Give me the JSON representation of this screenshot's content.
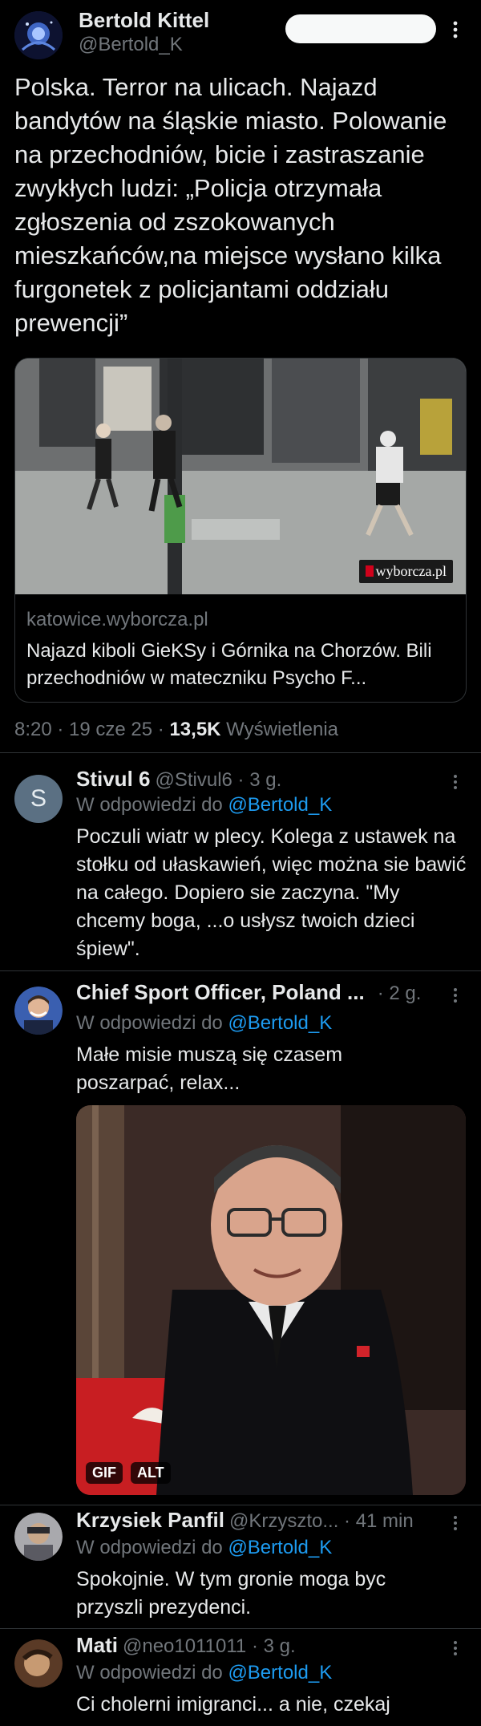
{
  "main_tweet": {
    "author_name": "Bertold Kittel",
    "author_handle": "@Bertold_K",
    "text": "Polska. Terror na ulicach. Najazd bandytów na śląskie miasto. Polowanie na przechodniów, bicie i zastraszanie zwykłych ludzi: „Policja otrzymała zgłoszenia od zszokowanych mieszkańców,na miejsce wysłano kilka furgonetek z policjantami oddziału prewencji”",
    "card": {
      "domain": "katowice.wyborcza.pl",
      "title": "Najazd kiboli GieKSy i Górnika na Chorzów. Bili przechodniów w mateczniku Psycho F...",
      "watermark": "wyborcza.pl"
    },
    "time": "8:20 · 19 cze 25 · ",
    "views_count": "13,5K",
    "views_label": " Wyświetlenia",
    "more_icon": "more-vertical-icon"
  },
  "replies": [
    {
      "avatar_letter": "S",
      "name": "Stivul 6",
      "handle_time": "@Stivul6 · 3 g.",
      "replying_prefix": "W odpowiedzi do ",
      "replying_to": "@Bertold_K",
      "text": "Poczuli wiatr w plecy. Kolega z ustawek na stołku od ułaskawień, więc można sie bawić na całego. Dopiero sie zaczyna. \"My chcemy boga, ...o usłysz twoich dzieci śpiew\"."
    },
    {
      "name": "Chief Sport Officer, Poland ...",
      "handle_time": "· 2 g.",
      "replying_prefix": "W odpowiedzi do ",
      "replying_to": "@Bertold_K",
      "text": "Małe misie muszą się czasem poszarpać, relax...",
      "media_badges": [
        "GIF",
        "ALT"
      ]
    },
    {
      "name": "Krzysiek Panfil",
      "handle_time": "@Krzyszto... · 41 min",
      "replying_prefix": "W odpowiedzi do ",
      "replying_to": "@Bertold_K",
      "text": "Spokojnie. W tym gronie moga byc przyszli prezydenci."
    },
    {
      "name": "Mati",
      "handle_time": "@neo1011011 · 3 g.",
      "replying_prefix": "W odpowiedzi do ",
      "replying_to": "@Bertold_K",
      "text": "Ci cholerni imigranci... a nie, czekaj"
    }
  ],
  "colors": {
    "background": "#000000",
    "text": "#e7e9ea",
    "muted": "#71767b",
    "link": "#1d9bf0",
    "border": "#2f3336"
  }
}
